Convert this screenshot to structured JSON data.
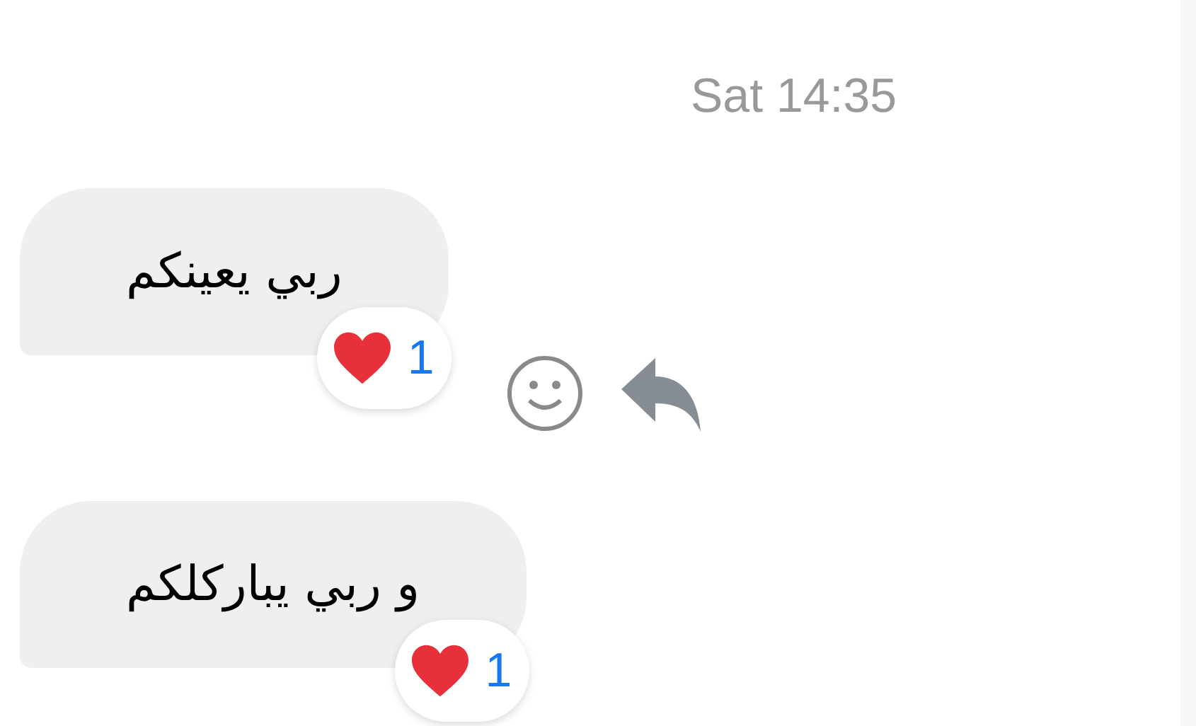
{
  "timestamp": "Sat 14:35",
  "messages": [
    {
      "text": "ربي يعينكم",
      "reaction": {
        "count": "1"
      },
      "show_actions": true
    },
    {
      "text": "و ربي يباركلكم",
      "reaction": {
        "count": "1"
      },
      "show_actions": false
    }
  ]
}
